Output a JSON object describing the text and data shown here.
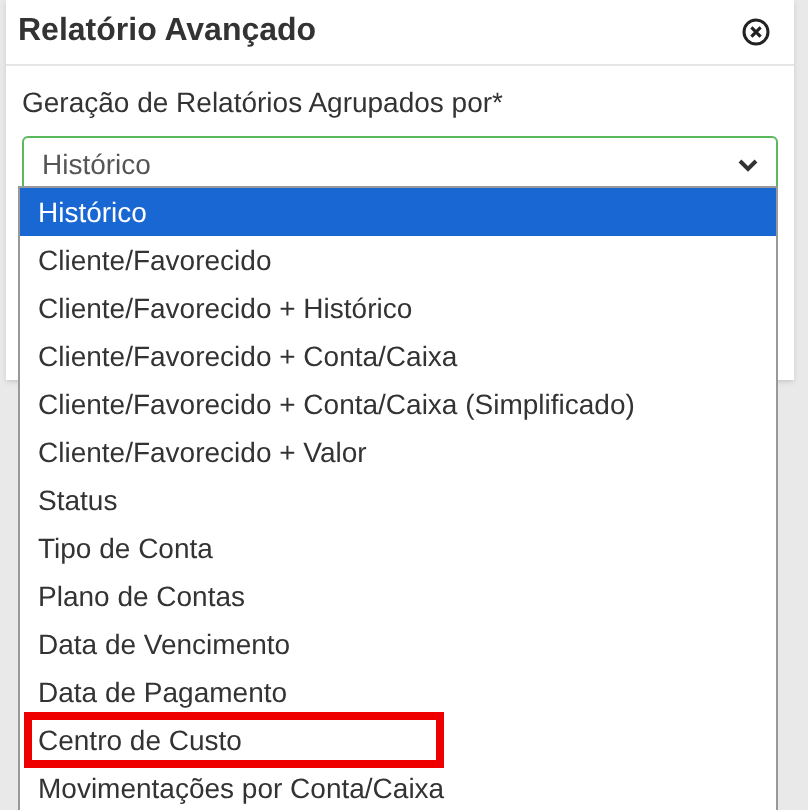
{
  "modal": {
    "title": "Relatório Avançado"
  },
  "field": {
    "label": "Geração de Relatórios Agrupados por*",
    "value": "Histórico"
  },
  "options": [
    {
      "label": "Histórico",
      "selected": true,
      "highlighted": false
    },
    {
      "label": "Cliente/Favorecido",
      "selected": false,
      "highlighted": false
    },
    {
      "label": "Cliente/Favorecido + Histórico",
      "selected": false,
      "highlighted": false
    },
    {
      "label": "Cliente/Favorecido + Conta/Caixa",
      "selected": false,
      "highlighted": false
    },
    {
      "label": "Cliente/Favorecido + Conta/Caixa (Simplificado)",
      "selected": false,
      "highlighted": false
    },
    {
      "label": "Cliente/Favorecido + Valor",
      "selected": false,
      "highlighted": false
    },
    {
      "label": "Status",
      "selected": false,
      "highlighted": false
    },
    {
      "label": "Tipo de Conta",
      "selected": false,
      "highlighted": false
    },
    {
      "label": "Plano de Contas",
      "selected": false,
      "highlighted": false
    },
    {
      "label": "Data de Vencimento",
      "selected": false,
      "highlighted": false
    },
    {
      "label": "Data de Pagamento",
      "selected": false,
      "highlighted": false
    },
    {
      "label": "Centro de Custo",
      "selected": false,
      "highlighted": true
    },
    {
      "label": "Movimentações por Conta/Caixa",
      "selected": false,
      "highlighted": false
    }
  ]
}
